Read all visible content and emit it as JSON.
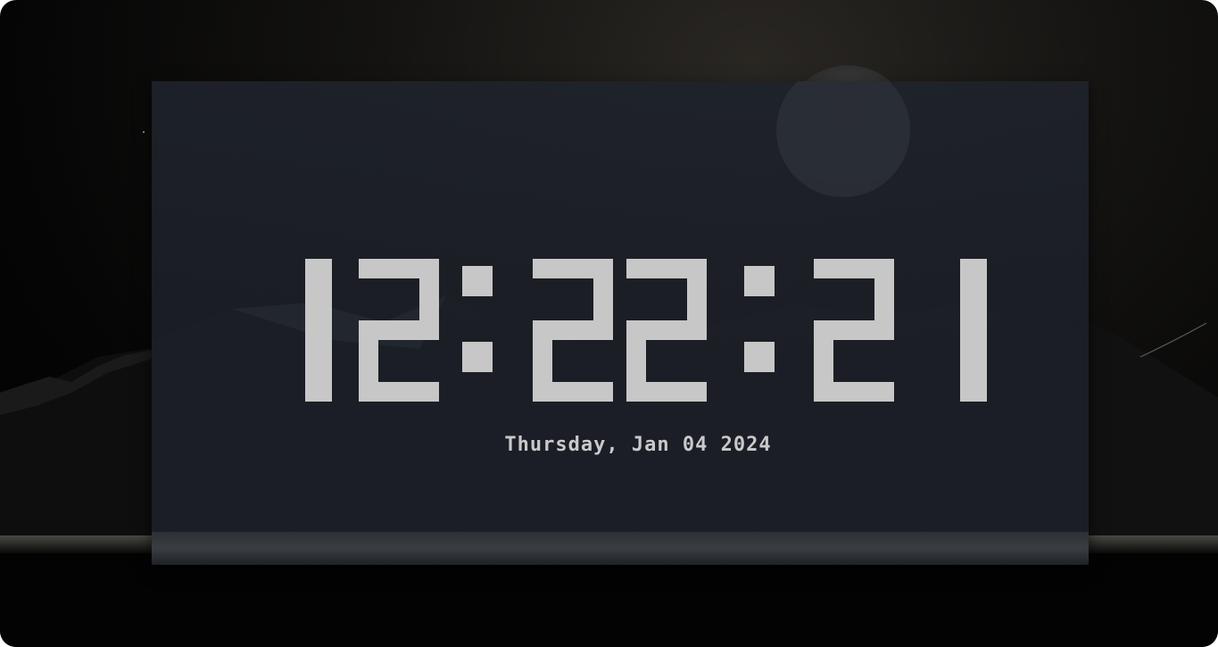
{
  "clock": {
    "time": "12:22:21",
    "date": "Thursday, Jan 04 2024",
    "digit_color": "#c6c7c6"
  },
  "theme": {
    "panel": "#1e222a",
    "date_text": "#c9c9c9"
  },
  "wallpaper": {
    "description_icon": "moon-over-mountains"
  }
}
